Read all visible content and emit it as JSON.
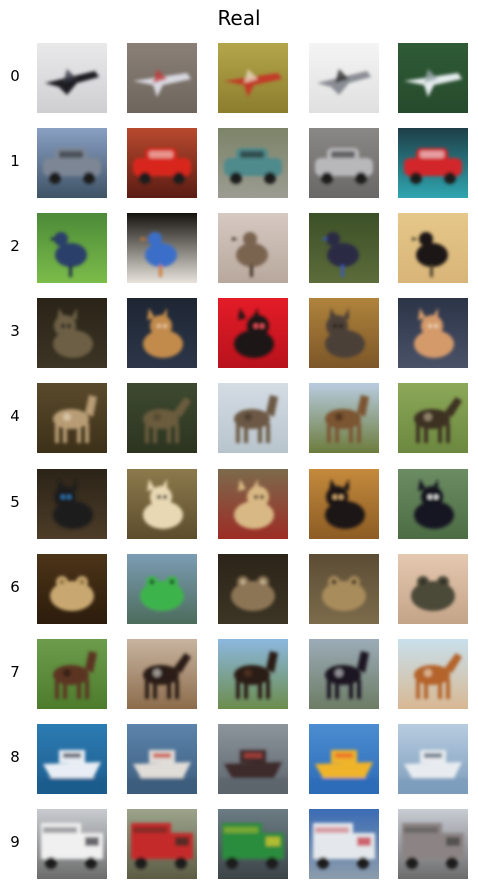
{
  "figure": {
    "title": "Real"
  },
  "rows": [
    {
      "label": "0",
      "images": [
        {
          "subject": "black stealth aircraft",
          "bg": "#e9e9ea",
          "ground": "#cfcfd2",
          "fg": "#1c1c22",
          "accent": "#3a3a44"
        },
        {
          "subject": "white and red jet on runway",
          "bg": "#8a8078",
          "ground": "#6e655d",
          "fg": "#d8d8e0",
          "accent": "#c43a3a"
        },
        {
          "subject": "red propeller plane on grass",
          "bg": "#b3a64a",
          "ground": "#8c7d2e",
          "fg": "#c23b25",
          "accent": "#e8d8c0"
        },
        {
          "subject": "grey propeller plane",
          "bg": "#f4f4f4",
          "ground": "#e0e0e0",
          "fg": "#8a8e94",
          "accent": "#2a2a2a"
        },
        {
          "subject": "white jet fighter over forest",
          "bg": "#2f5b36",
          "ground": "#264a2c",
          "fg": "#e6ecee",
          "accent": "#9aa8ac"
        }
      ]
    },
    {
      "label": "1",
      "images": [
        {
          "subject": "grey station wagon",
          "bg": "#8aa0c4",
          "ground": "#3e5366",
          "fg": "#7d8694",
          "accent": "#2a2e34"
        },
        {
          "subject": "red sports car",
          "bg": "#b84a2e",
          "ground": "#5a1c14",
          "fg": "#d8271d",
          "accent": "#f0e0d8"
        },
        {
          "subject": "teal vintage car",
          "bg": "#7c8468",
          "ground": "#9c9c92",
          "fg": "#4f8a8c",
          "accent": "#1e2628"
        },
        {
          "subject": "silver hatchback",
          "bg": "#8a8886",
          "ground": "#6a6866",
          "fg": "#b8b8ba",
          "accent": "#2c2c2e"
        },
        {
          "subject": "red car in showroom",
          "bg": "#1e3e48",
          "ground": "#2fa6b0",
          "fg": "#d2252a",
          "accent": "#f2f2f2"
        }
      ]
    },
    {
      "label": "2",
      "images": [
        {
          "subject": "blue bird in foliage",
          "bg": "#4c8a38",
          "ground": "#7cbc4a",
          "fg": "#2c3f6a",
          "accent": "#1c2a48"
        },
        {
          "subject": "bluebird on birdhouse",
          "bg": "#16130f",
          "ground": "#e8e4dc",
          "fg": "#3a6ec8",
          "accent": "#d27a36"
        },
        {
          "subject": "brown sparrow",
          "bg": "#d6c9c2",
          "ground": "#b8a89c",
          "fg": "#7a6450",
          "accent": "#3a2e24"
        },
        {
          "subject": "cassowary among plants",
          "bg": "#3c5028",
          "ground": "#5c6c3a",
          "fg": "#2c2a44",
          "accent": "#3a58b8"
        },
        {
          "subject": "ostrich on sand",
          "bg": "#e6c88a",
          "ground": "#d8b478",
          "fg": "#1a1612",
          "accent": "#4a3c2c"
        }
      ]
    },
    {
      "label": "3",
      "images": [
        {
          "subject": "tabby cat in dark",
          "bg": "#2a2418",
          "ground": "#3c3424",
          "fg": "#6c5e44",
          "accent": "#181410"
        },
        {
          "subject": "orange cat lying",
          "bg": "#1e2634",
          "ground": "#2c3648",
          "fg": "#c28a4c",
          "accent": "#e8c8a0"
        },
        {
          "subject": "black cat on red cushion",
          "bg": "#e41c28",
          "ground": "#b8121c",
          "fg": "#1a1416",
          "accent": "#ff5a64"
        },
        {
          "subject": "grey fluffy cat",
          "bg": "#b0843c",
          "ground": "#7c5628",
          "fg": "#4c4038",
          "accent": "#22180e"
        },
        {
          "subject": "ginger cat on blanket",
          "bg": "#2c3448",
          "ground": "#4a5268",
          "fg": "#d49a6a",
          "accent": "#ecd4b4"
        }
      ]
    },
    {
      "label": "4",
      "images": [
        {
          "subject": "deer in brush",
          "bg": "#5a4a2c",
          "ground": "#3c3018",
          "fg": "#b89c74",
          "accent": "#e8dcc4"
        },
        {
          "subject": "deer in forest",
          "bg": "#3e4a30",
          "ground": "#2c3420",
          "fg": "#6a5c3c",
          "accent": "#4c4428"
        },
        {
          "subject": "fawn in snow",
          "bg": "#d4dce4",
          "ground": "#b8c4cc",
          "fg": "#6c5844",
          "accent": "#3c3028"
        },
        {
          "subject": "elk on grassland",
          "bg": "#b8cce0",
          "ground": "#6c7c3c",
          "fg": "#7c5430",
          "accent": "#3c2818"
        },
        {
          "subject": "elk with antlers",
          "bg": "#8ca858",
          "ground": "#6c8840",
          "fg": "#3e3024",
          "accent": "#c8b898"
        }
      ]
    },
    {
      "label": "5",
      "images": [
        {
          "subject": "dog in blue jacket",
          "bg": "#2c2418",
          "ground": "#4c3c28",
          "fg": "#1e1c1c",
          "accent": "#2e7cb8"
        },
        {
          "subject": "fluffy white dog",
          "bg": "#8c7a4c",
          "ground": "#5c4c2c",
          "fg": "#e8d8b4",
          "accent": "#1c1814"
        },
        {
          "subject": "chihuahua on red",
          "bg": "#7c6a4c",
          "ground": "#9c2c24",
          "fg": "#d8b884",
          "accent": "#3c2c1c"
        },
        {
          "subject": "black dog lying",
          "bg": "#c48a3c",
          "ground": "#8c5c24",
          "fg": "#1c1816",
          "accent": "#e8b878"
        },
        {
          "subject": "husky puppy on grass",
          "bg": "#6c8c64",
          "ground": "#4c6c44",
          "fg": "#181820",
          "accent": "#f0f0f0"
        }
      ]
    },
    {
      "label": "6",
      "images": [
        {
          "subject": "frog on moss",
          "bg": "#4c3418",
          "ground": "#2c1c0c",
          "fg": "#c8a870",
          "accent": "#8c6c3c"
        },
        {
          "subject": "green toy frog",
          "bg": "#7c9cb4",
          "ground": "#4c6c5c",
          "fg": "#3cb44c",
          "accent": "#1c4c2c"
        },
        {
          "subject": "brown toad on ground",
          "bg": "#2c2418",
          "ground": "#3c3424",
          "fg": "#8c7454",
          "accent": "#c8b494"
        },
        {
          "subject": "toad on rocks",
          "bg": "#5c4c34",
          "ground": "#7c6c4c",
          "fg": "#a88c5c",
          "accent": "#3c2c1c"
        },
        {
          "subject": "toad in hand",
          "bg": "#e4c8b0",
          "ground": "#c4a488",
          "fg": "#4c4838",
          "accent": "#2c2820"
        }
      ]
    },
    {
      "label": "7",
      "images": [
        {
          "subject": "brown horse on grass",
          "bg": "#6c9c4c",
          "ground": "#4c7c2c",
          "fg": "#5c3420",
          "accent": "#1c1410"
        },
        {
          "subject": "horse with rider",
          "bg": "#c8b4a0",
          "ground": "#8c6c4c",
          "fg": "#2c1c14",
          "accent": "#e8e4e0"
        },
        {
          "subject": "dark horse in field",
          "bg": "#8cb8e0",
          "ground": "#6c8c4c",
          "fg": "#2c1c14",
          "accent": "#5c3c24"
        },
        {
          "subject": "black and white horse",
          "bg": "#9cacb8",
          "ground": "#6c7c64",
          "fg": "#1c1820",
          "accent": "#e0e0e4"
        },
        {
          "subject": "chestnut horse",
          "bg": "#c8e0ec",
          "ground": "#d8b894",
          "fg": "#b4642c",
          "accent": "#f4e4cc"
        }
      ]
    },
    {
      "label": "8",
      "images": [
        {
          "subject": "white speedboat",
          "bg": "#2c7cb4",
          "ground": "#1c5c8c",
          "fg": "#e8eef4",
          "accent": "#3c3c44"
        },
        {
          "subject": "boat in harbor",
          "bg": "#5c84ac",
          "ground": "#3c5c7c",
          "fg": "#e0dcd8",
          "accent": "#c43c2c"
        },
        {
          "subject": "cargo ship at sea",
          "bg": "#8c949c",
          "ground": "#5c646c",
          "fg": "#3c2c2c",
          "accent": "#c4443c"
        },
        {
          "subject": "people on yellow banana boat",
          "bg": "#4c8cd0",
          "ground": "#2c6cb8",
          "fg": "#f0b42c",
          "accent": "#e85c2c"
        },
        {
          "subject": "white yacht",
          "bg": "#b8cce0",
          "ground": "#7c9cbc",
          "fg": "#e8ecf0",
          "accent": "#4c5c6c"
        }
      ]
    },
    {
      "label": "9",
      "images": [
        {
          "subject": "white semi truck",
          "bg": "#c8ccd0",
          "ground": "#6c6c6c",
          "fg": "#f0f0f0",
          "accent": "#2c2c34"
        },
        {
          "subject": "dump truck unloading",
          "bg": "#9ca48c",
          "ground": "#5c5c44",
          "fg": "#c42c2c",
          "accent": "#2c2c24"
        },
        {
          "subject": "green truck",
          "bg": "#6c7c84",
          "ground": "#3c4448",
          "fg": "#2c8c3c",
          "accent": "#e8d02c"
        },
        {
          "subject": "white trailer truck",
          "bg": "#3c6cb4",
          "ground": "#8c9cac",
          "fg": "#e4e8ec",
          "accent": "#c42c3c"
        },
        {
          "subject": "truck with people",
          "bg": "#c8ccd4",
          "ground": "#6c6c6c",
          "fg": "#8c8484",
          "accent": "#3c3c3c"
        }
      ]
    }
  ]
}
